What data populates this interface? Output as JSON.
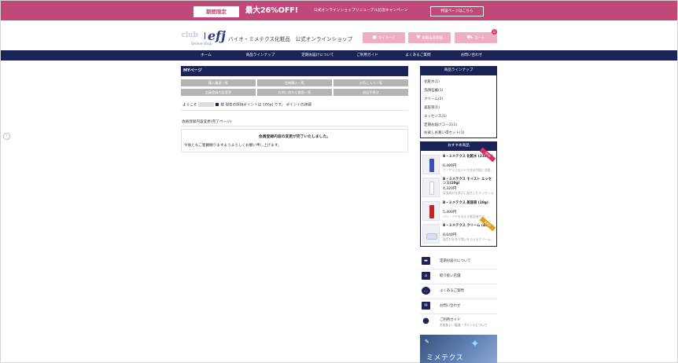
{
  "promo": {
    "tag": "期間限定",
    "headline": "最大26%OFF!",
    "subtext": "公式オンラインショップリニューアル記念キャンペーン",
    "cta": "特設ページはこちら"
  },
  "header": {
    "logo_club": "club",
    "logo_efj": "efj",
    "logo_online": "Online shop",
    "title": "バイオ・ミメテクス化粧品　公式オンラインショップ",
    "mypage": "マイページ",
    "regular": "定期会員登録",
    "cart": "カート",
    "cart_count": "0"
  },
  "nav": [
    "ホーム",
    "商品ラインナップ",
    "定期お届けについて",
    "ご利用ガイド",
    "よくあるご質問",
    "お問い合わせ"
  ],
  "mypage": {
    "heading": "MYページ",
    "buttons": [
      "購入履歴一覧",
      "定期購入一覧",
      "お気に入り一覧",
      "会員登録内容変更",
      "お問い合わせ履歴一覧",
      "退会手続き"
    ],
    "welcome_prefix": "ようこそ",
    "welcome_suffix": "様 現在の所持ポイントは 100pt です。 ポイントの詳細",
    "section_title": "会員登録内容変更(完了ページ)",
    "complete_msg": "会員登録内容の変更が完了いたしました。",
    "thanks_msg": "今後ともご愛顧賜りますようよろしくお願い申し上げます。"
  },
  "sidebar": {
    "lineup_heading": "商品ラインナップ",
    "lineup": [
      "化粧水(1)",
      "洗顔石鹸(1)",
      "クリーム(2)",
      "美容液(1)",
      "エッセンス(1)",
      "定期お届けコース(1)",
      "お試しお買い得セット(1)"
    ],
    "recommend_heading": "おすすめ商品",
    "recommend": [
      {
        "name": "B・ミメテクス 化粧水 (210ml)",
        "price": "6,480円",
        "desc": "ナノサイズのバイオ成分が肌に浸透…",
        "ribbon": "NEW",
        "color": "#3a4fb0",
        "ribbon_color": "#d8335e"
      },
      {
        "name": "B・ミメテクス モイスト エッセンス(10g)",
        "price": "4,320円",
        "desc": "保湿成分を贅沢に配合したエッセンス…",
        "ribbon": "",
        "color": "#d4d6dc",
        "ribbon_color": ""
      },
      {
        "name": "B・ミメテクス 美容液 (10g)",
        "price": "5,400円",
        "desc": "ハリ・ツヤを与える美容液です。…",
        "ribbon": "",
        "color": "#c62323",
        "ribbon_color": ""
      },
      {
        "name": "B・ミメテクス クリーム (40g)",
        "price": "8,640円",
        "desc": "肌荒れを防ぎ潤いを与えるクリーム…",
        "ribbon": "SALE",
        "color": "#d9def0",
        "ribbon_color": "#d9a320"
      }
    ],
    "info": [
      {
        "icon": "truck-icon",
        "glyph": "🚚",
        "label": "定期お届けについて",
        "sub": ""
      },
      {
        "icon": "shop-icon",
        "glyph": "⌂",
        "label": "取り扱い店舗",
        "sub": ""
      },
      {
        "icon": "chat-icon",
        "glyph": "…",
        "label": "よくあるご質問",
        "sub": ""
      },
      {
        "icon": "mail-icon",
        "glyph": "✉",
        "label": "お問い合わせ",
        "sub": ""
      },
      {
        "icon": "drop-icon",
        "glyph": "●",
        "label": "ご利用ガイド",
        "sub": "お支払い・配送・ポイントについて"
      }
    ],
    "banner_text": "ミメテクス"
  },
  "colors": {
    "navy": "#1c2457",
    "pink": "#c0497a",
    "light_pink": "#efaec6"
  }
}
